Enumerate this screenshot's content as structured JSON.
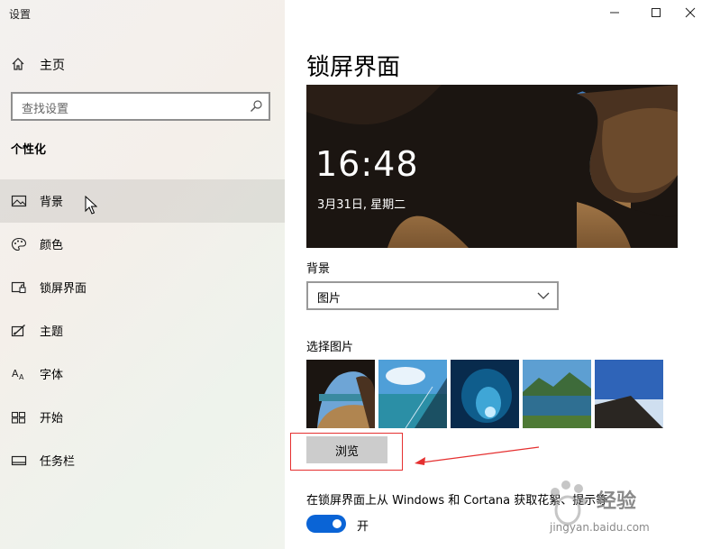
{
  "window": {
    "title": "设置",
    "controls": [
      "minimize-icon",
      "maximize-icon",
      "close-icon"
    ]
  },
  "sidebar": {
    "home_label": "主页",
    "search_placeholder": "查找设置",
    "section_title": "个性化",
    "items": [
      {
        "label": "背景",
        "icon": "image-icon",
        "selected": true
      },
      {
        "label": "颜色",
        "icon": "palette-icon",
        "selected": false
      },
      {
        "label": "锁屏界面",
        "icon": "lock-screen-icon",
        "selected": false
      },
      {
        "label": "主题",
        "icon": "theme-icon",
        "selected": false
      },
      {
        "label": "字体",
        "icon": "font-icon",
        "selected": false
      },
      {
        "label": "开始",
        "icon": "start-icon",
        "selected": false
      },
      {
        "label": "任务栏",
        "icon": "taskbar-icon",
        "selected": false
      }
    ]
  },
  "main": {
    "page_title": "锁屏界面",
    "preview": {
      "time": "16:48",
      "date": "3月31日, 星期二"
    },
    "background_label": "背景",
    "background_value": "图片",
    "choose_picture_label": "选择图片",
    "browse_label": "浏览",
    "lock_screen_info_label": "在锁屏界面上从 Windows 和 Cortana 获取花絮、提示等",
    "toggle_state": "开"
  },
  "watermark": {
    "text": "经验",
    "url": "jingyan.baidu.com"
  },
  "colors": {
    "accent": "#0a64d6",
    "annotation_red": "#e53030"
  }
}
